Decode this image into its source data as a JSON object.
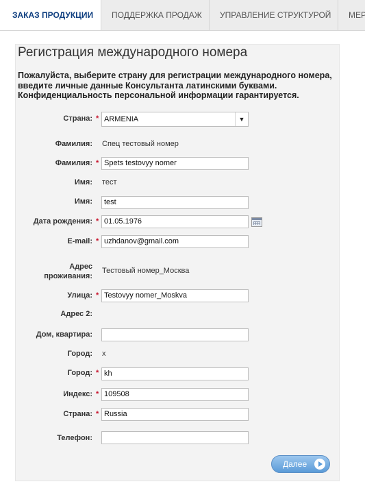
{
  "tabs": [
    {
      "label": "ЗАКАЗ ПРОДУКЦИИ",
      "active": true
    },
    {
      "label": "ПОДДЕРЖКА ПРОДАЖ",
      "active": false
    },
    {
      "label": "УПРАВЛЕНИЕ СТРУКТУРОЙ",
      "active": false
    },
    {
      "label": "МЕР",
      "active": false
    }
  ],
  "form": {
    "title": "Регистрация международного номера",
    "intro": "Пожалуйста, выберите страну для регистрации международного номера, введите личные данные Консультанта латинскими буквами. Конфиденциальность персональной информации гарантируется.",
    "required_mark": "*",
    "country": {
      "label": "Страна:",
      "value": "ARMENIA"
    },
    "surname_local": {
      "label": "Фамилия:",
      "value": "Спец тестовый номер"
    },
    "surname_latin": {
      "label": "Фамилия:",
      "value": "Spets testovyy nomer"
    },
    "name_local": {
      "label": "Имя:",
      "value": "тест"
    },
    "name_latin": {
      "label": "Имя:",
      "value": "test"
    },
    "birthdate": {
      "label": "Дата рождения:",
      "value": "01.05.1976"
    },
    "email": {
      "label": "E-mail:",
      "value": "uzhdanov@gmail.com"
    },
    "address_local": {
      "label_line1": "Адрес",
      "label_line2": "проживания:",
      "value": "Тестовый номер_Москва"
    },
    "street": {
      "label": "Улица:",
      "value": "Testovyy nomer_Moskva"
    },
    "address2": {
      "label": "Адрес 2:",
      "value": ""
    },
    "house": {
      "label": "Дом, квартира:",
      "value": ""
    },
    "city_local": {
      "label": "Город:",
      "value": "x"
    },
    "city_latin": {
      "label": "Город:",
      "value": "kh"
    },
    "zip": {
      "label": "Индекс:",
      "value": "109508"
    },
    "country_text": {
      "label": "Страна:",
      "value": "Russia"
    },
    "phone": {
      "label": "Телефон:",
      "value": ""
    },
    "next_button": "Далее"
  },
  "colors": {
    "accent": "#0f3f80",
    "required": "#c8142d",
    "button": "#5b9bd8"
  }
}
